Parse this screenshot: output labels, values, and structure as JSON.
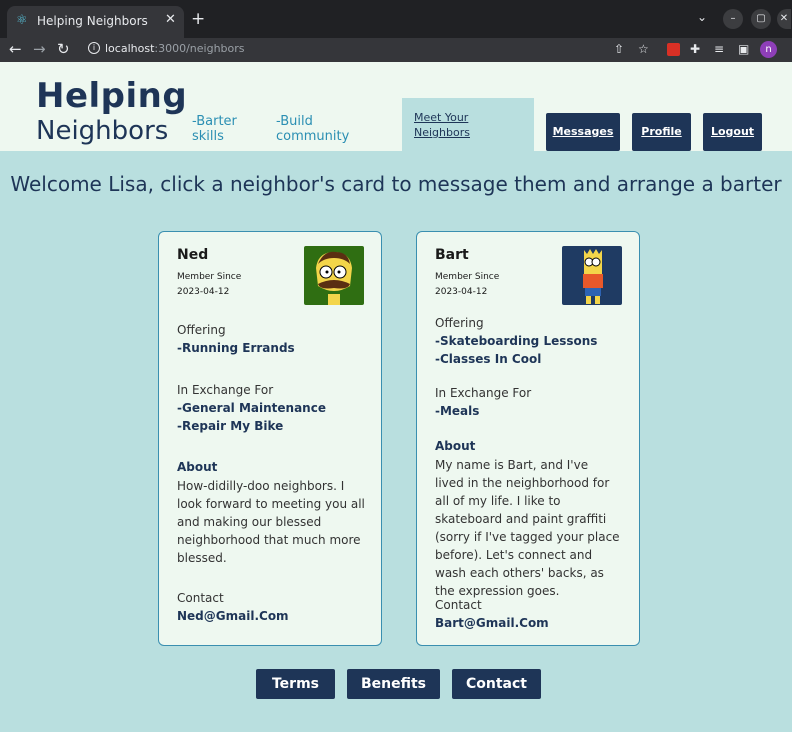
{
  "browser": {
    "tab_title": "Helping Neighbors",
    "url_host": "localhost",
    "url_path": ":3000/neighbors",
    "profile_initial": "n"
  },
  "header": {
    "brand_line1": "Helping",
    "brand_line2": "Neighbors",
    "tagline1": "-Barter skills",
    "tagline2": "-Build community",
    "nav": {
      "meet": "Meet Your Neighbors",
      "messages": "Messages",
      "profile": "Profile",
      "logout": "Logout"
    }
  },
  "welcome": "Welcome Lisa, click a neighbor's card to message them and arrange a barter",
  "cards": [
    {
      "name": "Ned",
      "member_since_label": "Member Since",
      "member_since": "2023-04-12",
      "offering_label": "Offering",
      "offering": [
        "-Running Errands"
      ],
      "exchange_label": "In Exchange For",
      "exchange": [
        "-General Maintenance",
        "-Repair My Bike"
      ],
      "about_label": "About",
      "about": "How-didilly-doo neighbors. I look forward to meeting you all and making our blessed neighborhood that much more blessed.",
      "contact_label": "Contact",
      "contact": "Ned@Gmail.Com"
    },
    {
      "name": "Bart",
      "member_since_label": "Member Since",
      "member_since": "2023-04-12",
      "offering_label": "Offering",
      "offering": [
        "-Skateboarding Lessons",
        "-Classes In Cool"
      ],
      "exchange_label": "In Exchange For",
      "exchange": [
        "-Meals"
      ],
      "about_label": "About",
      "about": "My name is Bart, and I've lived in the neighborhood for all of my life. I like to skateboard and paint graffiti (sorry if I've tagged your place before). Let's connect and wash each others' backs, as the expression goes.",
      "contact_label": "Contact",
      "contact": "Bart@Gmail.Com"
    }
  ],
  "footer": {
    "terms": "Terms",
    "benefits": "Benefits",
    "contact": "Contact"
  },
  "colors": {
    "navy": "#1e3557",
    "teal_bg": "#b9dfdf",
    "cream": "#eef8f0",
    "link_blue": "#2b8fb3"
  }
}
